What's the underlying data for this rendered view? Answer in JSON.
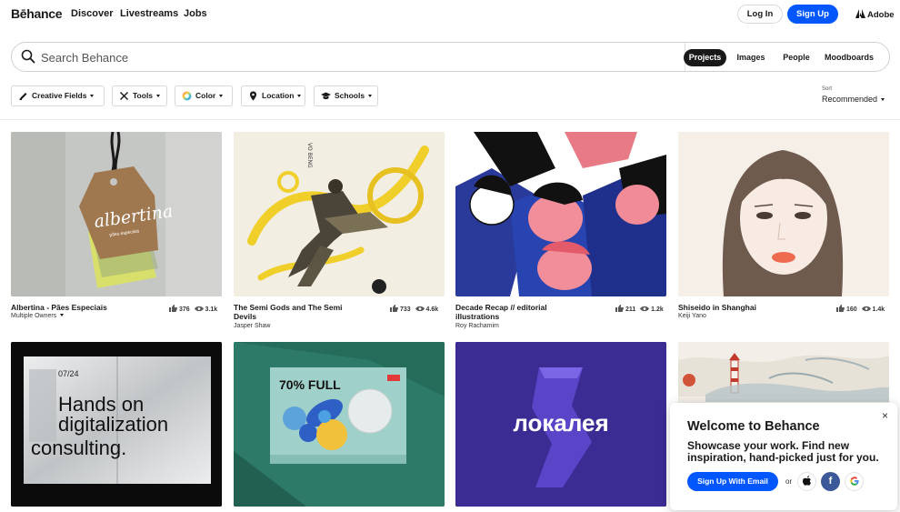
{
  "header": {
    "logo": "Bēhance",
    "nav": [
      "Discover",
      "Livestreams",
      "Jobs"
    ],
    "login_label": "Log In",
    "signup_label": "Sign Up",
    "adobe_label": "Adobe"
  },
  "search": {
    "placeholder": "Search Behance",
    "tabs": [
      "Projects",
      "Images",
      "People",
      "Moodboards"
    ],
    "active_tab": "Projects"
  },
  "filters": [
    "Creative Fields",
    "Tools",
    "Color",
    "Location",
    "Schools"
  ],
  "sort": {
    "label": "Sort",
    "value": "Recommended"
  },
  "projects": [
    {
      "title": "Albertina - Pães Especiais",
      "owner": "Multiple Owners",
      "likes": "376",
      "views": "3.1k"
    },
    {
      "title": "The Semi Gods and The Semi Devils",
      "owner": "Jasper Shaw",
      "likes": "733",
      "views": "4.6k"
    },
    {
      "title": "Decade Recap // editorial illustrations",
      "owner": "Roy Rachamim",
      "likes": "211",
      "views": "1.2k"
    },
    {
      "title": "Shiseido in Shanghai",
      "owner": "Keiji Yano",
      "likes": "160",
      "views": "1.4k"
    }
  ],
  "thumb_text": {
    "tag": "albertina",
    "tag_sub": "pães especiais",
    "poster_date": "07/24",
    "poster_line1": "Hands on",
    "poster_line2": "digitalization",
    "poster_line3": "consulting.",
    "box_text": "70% FULL",
    "lokaleya": "локалея"
  },
  "popup": {
    "close": "×",
    "title": "Welcome to Behance",
    "body": "Showcase your work. Find new inspiration, hand-picked just for you.",
    "signup_email": "Sign Up With Email",
    "or": "or"
  },
  "colors": {
    "brand_blue": "#0057ff",
    "text": "#191919"
  }
}
